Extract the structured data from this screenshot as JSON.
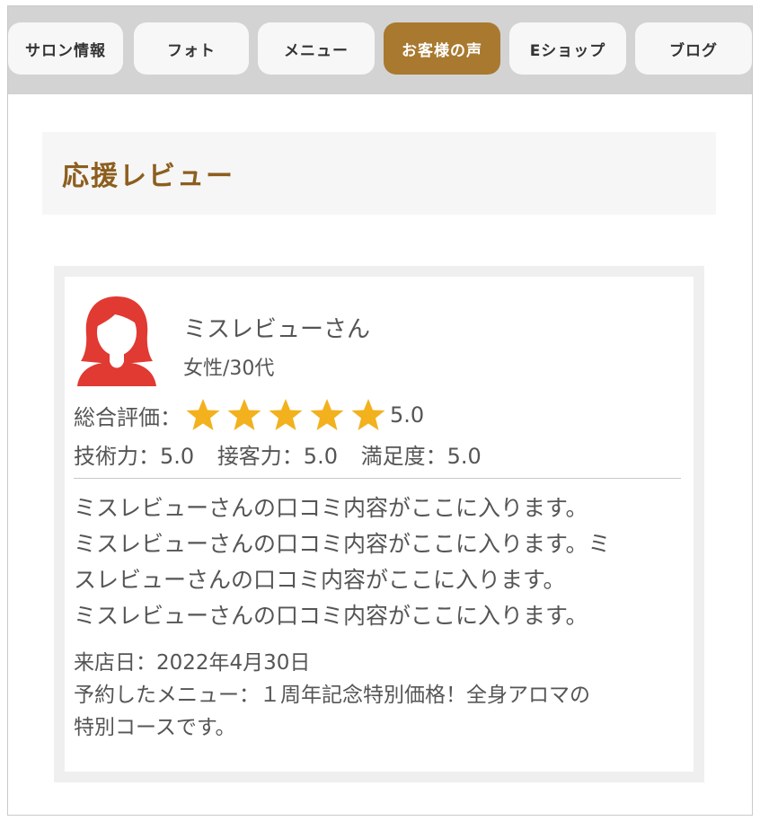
{
  "nav": {
    "tabs": [
      {
        "label": "サロン情報",
        "active": false
      },
      {
        "label": "フォト",
        "active": false
      },
      {
        "label": "メニュー",
        "active": false
      },
      {
        "label": "お客様の声",
        "active": true
      },
      {
        "label": "Eショップ",
        "active": false
      },
      {
        "label": "ブログ",
        "active": false
      }
    ]
  },
  "section": {
    "title": "応援レビュー"
  },
  "review": {
    "avatar_icon": "woman-avatar-icon",
    "reviewer_name": "ミスレビューさん",
    "reviewer_demographic": "女性/30代",
    "overall_label": "総合評価：",
    "overall_rating": 5.0,
    "overall_score_text": "5.0",
    "star_count": 5,
    "star_color": "#f2b11d",
    "subscores": [
      {
        "text": "技術力：5.0"
      },
      {
        "text": "接客力：5.0"
      },
      {
        "text": "満足度：5.0"
      }
    ],
    "body_lines": [
      "ミスレビューさんの口コミ内容がここに入ります。",
      "ミスレビューさんの口コミ内容がここに入ります。ミ",
      "スレビューさんの口コミ内容がここに入ります。",
      "ミスレビューさんの口コミ内容がここに入ります。"
    ],
    "visit_date": "来店日：2022年4月30日",
    "menu_line_1": "予約したメニュー：１周年記念特別価格！全身アロマの",
    "menu_line_2": "特別コースです。"
  },
  "colors": {
    "accent": "#a8792f",
    "title_brown": "#8c5e1e",
    "avatar_red": "#e03a32"
  }
}
